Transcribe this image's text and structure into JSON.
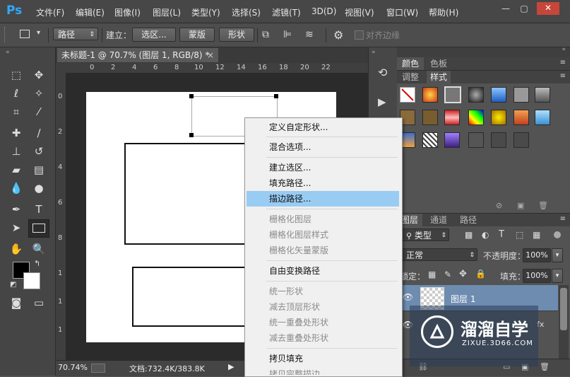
{
  "app": {
    "logo": "Ps"
  },
  "menu": [
    "文件(F)",
    "编辑(E)",
    "图像(I)",
    "图层(L)",
    "类型(Y)",
    "选择(S)",
    "滤镜(T)",
    "3D(D)",
    "视图(V)",
    "窗口(W)",
    "帮助(H)"
  ],
  "window_controls": {
    "minimize": "—",
    "restore": "▢",
    "close": "✕"
  },
  "options": {
    "mode_select": "路径",
    "make_label": "建立：",
    "selection_btn": "选区...",
    "mask_btn": "蒙版",
    "shape_btn": "形状",
    "align_edges": "对齐边缘"
  },
  "document": {
    "tab_title": "未标题-1 @ 70.7% (图层 1, RGB/8) *",
    "close": "×",
    "ruler_top": [
      "0",
      "2",
      "4",
      "6",
      "8",
      "10",
      "12",
      "14",
      "16",
      "18",
      "20",
      "22"
    ],
    "ruler_left": [
      "0",
      "2",
      "4",
      "6",
      "8",
      "1",
      "1",
      "1"
    ],
    "zoom": "70.74%",
    "doc_info": "文档:732.4K/383.8K"
  },
  "panels": {
    "color_tab": "颜色",
    "swatches_tab": "色板",
    "adjust_tab": "调整",
    "styles_tab": "样式",
    "layers_tab": "图层",
    "channels_tab": "通道",
    "paths_tab": "路径",
    "filter_kind": "类型",
    "blend_mode": "正常",
    "opacity_label": "不透明度：",
    "opacity_value": "100%",
    "lock_label": "锁定：",
    "fill_label": "填充：",
    "fill_value": "100%",
    "layer_name": "图层 1",
    "fx": "fx"
  },
  "context_menu": {
    "items": [
      {
        "label": "定义自定形状...",
        "disabled": false
      },
      {
        "label": "混合选项...",
        "disabled": false
      },
      {
        "label": "建立选区...",
        "disabled": false
      },
      {
        "label": "填充路径...",
        "disabled": false
      },
      {
        "label": "描边路径...",
        "disabled": false,
        "highlight": true
      },
      {
        "label": "栅格化图层",
        "disabled": true
      },
      {
        "label": "栅格化图层样式",
        "disabled": true
      },
      {
        "label": "栅格化矢量蒙版",
        "disabled": true
      },
      {
        "label": "自由变换路径",
        "disabled": false
      },
      {
        "label": "统一形状",
        "disabled": true
      },
      {
        "label": "减去顶层形状",
        "disabled": true
      },
      {
        "label": "统一重叠处形状",
        "disabled": true
      },
      {
        "label": "减去重叠处形状",
        "disabled": true
      },
      {
        "label": "拷贝填充",
        "disabled": false
      },
      {
        "label": "拷贝完整描边",
        "disabled": true
      }
    ]
  },
  "watermark": {
    "title": "溜溜自学",
    "url": "ZIXUE.3D66.COM"
  },
  "colors": {
    "highlight": "#99ccf3",
    "ps_blue": "#31a8ff",
    "layer_selected": "#6d8cb0"
  }
}
